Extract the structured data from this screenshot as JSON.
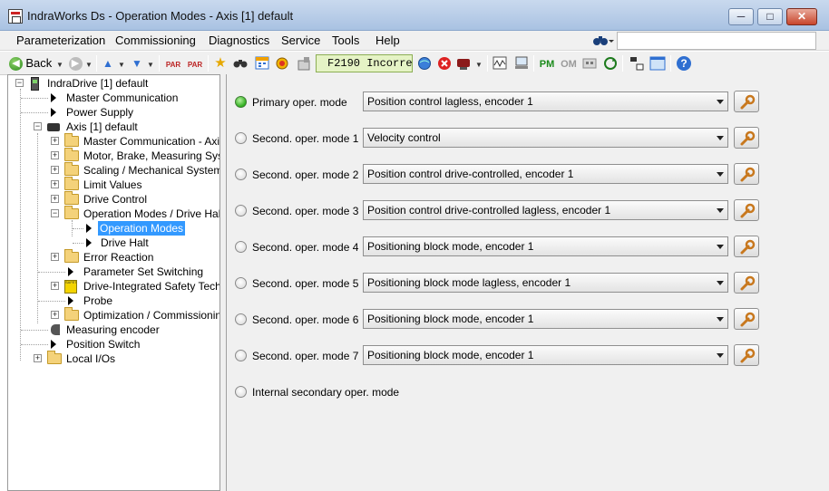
{
  "window": {
    "title": "IndraWorks Ds - Operation Modes - Axis [1] default",
    "buttons": {
      "minimize": "─",
      "maximize": "□",
      "close": "✕"
    }
  },
  "menu": {
    "items": [
      "Parameterization",
      "Commissioning",
      "Diagnostics",
      "Service",
      "Tools",
      "Help"
    ],
    "search_placeholder": ""
  },
  "toolbar": {
    "back_label": "Back",
    "status_text": "F2190 Incorre",
    "pm_label": "PM",
    "om_label": "OM",
    "par_label": "PAR",
    "help_glyph": "?"
  },
  "tree": [
    {
      "label": "IndraDrive [1] default",
      "icon": "device-icon",
      "expander": "−"
    },
    {
      "label": "Master Communication",
      "icon": "arrow-icon",
      "expander": ""
    },
    {
      "label": "Power Supply",
      "icon": "arrow-icon",
      "expander": ""
    },
    {
      "label": "Axis [1] default",
      "icon": "axis-icon",
      "expander": "−"
    },
    {
      "label": "Master Communication - Axis",
      "icon": "folder-icon",
      "expander": "+"
    },
    {
      "label": "Motor, Brake, Measuring System",
      "icon": "folder-icon",
      "expander": "+"
    },
    {
      "label": "Scaling / Mechanical System",
      "icon": "folder-icon",
      "expander": "+"
    },
    {
      "label": "Limit Values",
      "icon": "folder-icon",
      "expander": "+"
    },
    {
      "label": "Drive Control",
      "icon": "folder-icon",
      "expander": "+"
    },
    {
      "label": "Operation Modes / Drive Halt",
      "icon": "folder-icon",
      "expander": "−"
    },
    {
      "label": "Operation Modes",
      "icon": "arrow-icon",
      "expander": "",
      "selected": true
    },
    {
      "label": "Drive Halt",
      "icon": "arrow-icon",
      "expander": ""
    },
    {
      "label": "Error Reaction",
      "icon": "folder-icon",
      "expander": "+"
    },
    {
      "label": "Parameter Set Switching",
      "icon": "arrow-icon",
      "expander": ""
    },
    {
      "label": "Drive-Integrated Safety Technology",
      "icon": "safety-icon",
      "expander": "+"
    },
    {
      "label": "Probe",
      "icon": "arrow-icon",
      "expander": ""
    },
    {
      "label": "Optimization / Commissioning",
      "icon": "folder-icon",
      "expander": "+"
    },
    {
      "label": "Measuring encoder",
      "icon": "encoder-icon",
      "expander": ""
    },
    {
      "label": "Position Switch",
      "icon": "arrow-icon",
      "expander": ""
    },
    {
      "label": "Local I/Os",
      "icon": "folder-icon",
      "expander": "+"
    }
  ],
  "safety_icon_text": "SAFETY ON BOARD",
  "modes": [
    {
      "label": "Primary oper. mode",
      "value": "Position control lagless, encoder 1",
      "active": true
    },
    {
      "label": "Second. oper. mode 1",
      "value": "Velocity control",
      "active": false
    },
    {
      "label": "Second. oper. mode 2",
      "value": "Position control drive-controlled, encoder 1",
      "active": false
    },
    {
      "label": "Second. oper. mode 3",
      "value": "Position control drive-controlled lagless, encoder 1",
      "active": false
    },
    {
      "label": "Second. oper. mode 4",
      "value": "Positioning block mode, encoder 1",
      "active": false
    },
    {
      "label": "Second. oper. mode 5",
      "value": "Positioning block mode lagless, encoder 1",
      "active": false
    },
    {
      "label": "Second. oper. mode 6",
      "value": "Positioning block mode, encoder 1",
      "active": false
    },
    {
      "label": "Second. oper. mode 7",
      "value": "Positioning block mode, encoder 1",
      "active": false
    }
  ],
  "internal_mode_label": "Internal secondary oper. mode",
  "colors": {
    "selection": "#3399ff",
    "active_indicator": "#2fae1e",
    "status_field": "#e5f3c5"
  }
}
